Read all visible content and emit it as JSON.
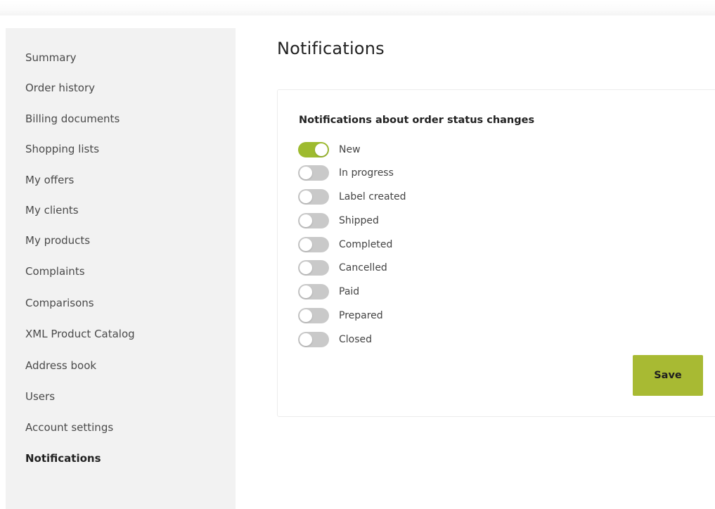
{
  "sidebar": {
    "items": [
      {
        "label": "Summary",
        "active": false
      },
      {
        "label": "Order history",
        "active": false
      },
      {
        "label": "Billing documents",
        "active": false
      },
      {
        "label": "Shopping lists",
        "active": false
      },
      {
        "label": "My offers",
        "active": false
      },
      {
        "label": "My clients",
        "active": false
      },
      {
        "label": "My products",
        "active": false
      },
      {
        "label": "Complaints",
        "active": false
      },
      {
        "label": "Comparisons",
        "active": false
      },
      {
        "label": "XML Product Catalog",
        "active": false
      },
      {
        "label": "Address book",
        "active": false
      },
      {
        "label": "Users",
        "active": false
      },
      {
        "label": "Account settings",
        "active": false
      },
      {
        "label": "Notifications",
        "active": true
      }
    ]
  },
  "main": {
    "title": "Notifications",
    "section_title": "Notifications about order status changes",
    "toggles": [
      {
        "label": "New",
        "enabled": true
      },
      {
        "label": "In progress",
        "enabled": false
      },
      {
        "label": "Label created",
        "enabled": false
      },
      {
        "label": "Shipped",
        "enabled": false
      },
      {
        "label": "Completed",
        "enabled": false
      },
      {
        "label": "Cancelled",
        "enabled": false
      },
      {
        "label": "Paid",
        "enabled": false
      },
      {
        "label": "Prepared",
        "enabled": false
      },
      {
        "label": "Closed",
        "enabled": false
      }
    ],
    "save_label": "Save"
  },
  "colors": {
    "accent": "#a8ba33",
    "toggle_on": "#9ebb2f",
    "toggle_off": "#c9c9c9",
    "sidebar_bg": "#f2f2f2"
  }
}
